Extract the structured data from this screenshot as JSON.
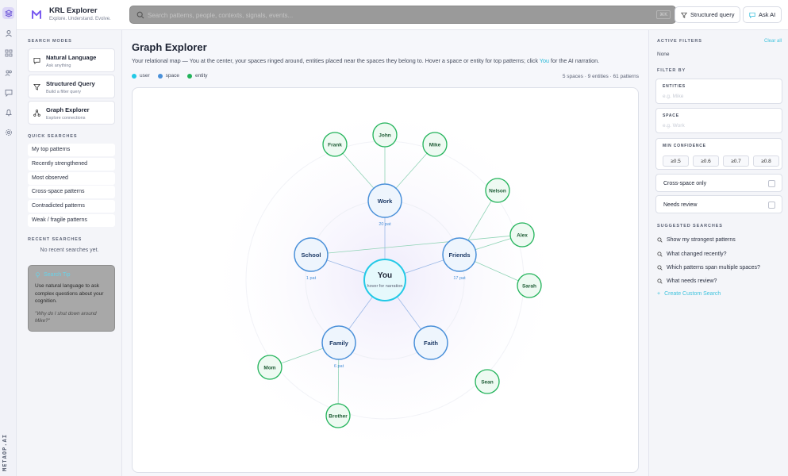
{
  "rail": {
    "brand": "METAOP.AI",
    "icons": [
      "layers-icon",
      "user-icon",
      "grid-icon",
      "people-icon",
      "chat-icon",
      "bell-icon",
      "settings-icon"
    ]
  },
  "header": {
    "app_title": "KRL Explorer",
    "tagline": "Explore. Understand. Evolve.",
    "search_placeholder": "Search patterns, people, contexts, signals, events...",
    "search_shortcut": "⌘K",
    "structured_query_label": "Structured query",
    "ask_ai_label": "Ask AI"
  },
  "left": {
    "search_modes_title": "SEARCH MODES",
    "modes": [
      {
        "label": "Natural Language",
        "sub": "Ask anything",
        "icon": "chat-icon"
      },
      {
        "label": "Structured Query",
        "sub": "Build a filter query",
        "icon": "filter-icon"
      },
      {
        "label": "Graph Explorer",
        "sub": "Explore connections",
        "icon": "graph-icon"
      }
    ],
    "quick_title": "QUICK SEARCHES",
    "quick": [
      "My top patterns",
      "Recently strengthened",
      "Most observed",
      "Cross-space patterns",
      "Contradicted patterns",
      "Weak / fragile patterns"
    ],
    "recent_title": "RECENT SEARCHES",
    "recent_empty": "No recent searches yet.",
    "tip": {
      "title": "Search Tip",
      "text": "Use natural language to ask complex questions about your cognition.",
      "quote": "\"Why do I shut down around Mike?\""
    }
  },
  "main": {
    "title": "Graph Explorer",
    "desc_before": "Your relational map — You at the center, your spaces ringed around, entities placed near the spaces they belong to. Hover a space or entity for top patterns; click ",
    "desc_link": "You",
    "desc_after": " for the AI narration.",
    "legend": [
      {
        "label": "user",
        "color": "#22c9e6"
      },
      {
        "label": "space",
        "color": "#4a90d9"
      },
      {
        "label": "entity",
        "color": "#22b35a"
      }
    ],
    "stats": "5 spaces · 9 entities · 61 patterns"
  },
  "graph": {
    "colors": {
      "user": "#22c9e6",
      "space": "#4a90d9",
      "entity": "#22b35a",
      "edge_space": "#9bb8e6",
      "edge_entity": "#8fd3b5"
    },
    "center": {
      "label": "You",
      "sub": "hover for narration"
    },
    "spaces": [
      {
        "label": "Work",
        "patterns": "20 pat"
      },
      {
        "label": "School",
        "patterns": "1 pat"
      },
      {
        "label": "Friends",
        "patterns": "17 pat"
      },
      {
        "label": "Family",
        "patterns": "6 pat"
      },
      {
        "label": "Faith",
        "patterns": ""
      }
    ],
    "entities": [
      "Frank",
      "John",
      "Mike",
      "Nelson",
      "Alex",
      "Sarah",
      "Mom",
      "Brother",
      "Sean"
    ]
  },
  "right": {
    "active_title": "ACTIVE FILTERS",
    "clear_all": "Clear all",
    "none": "None",
    "filter_title": "FILTER BY",
    "entities_label": "ENTITIES",
    "entities_placeholder": "e.g. Mike",
    "space_label": "SPACE",
    "space_placeholder": "e.g. Work",
    "confidence_label": "MIN CONFIDENCE",
    "confidence_options": [
      "≥0.5",
      "≥0.6",
      "≥0.7",
      "≥0.8"
    ],
    "cross_space": "Cross-space only",
    "needs_review": "Needs review",
    "suggested_title": "SUGGESTED SEARCHES",
    "suggested": [
      "Show my strongest patterns",
      "What changed recently?",
      "Which patterns span multiple spaces?",
      "What needs review?"
    ],
    "create_custom": "Create Custom Search"
  }
}
